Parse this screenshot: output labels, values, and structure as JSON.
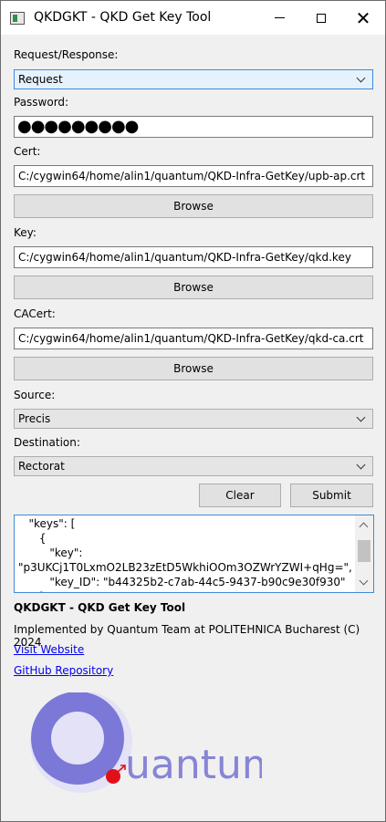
{
  "window": {
    "title": "QKDGKT - QKD Get Key Tool",
    "icons": {
      "minimize": "minimize-icon",
      "maximize": "maximize-icon",
      "close": "close-icon"
    }
  },
  "form": {
    "request_label": "Request/Response:",
    "request_value": "Request",
    "password_label": "Password:",
    "password_mask": "●●●●●●●●●",
    "cert_label": "Cert:",
    "cert_value": "C:/cygwin64/home/alin1/quantum/QKD-Infra-GetKey/upb-ap.crt",
    "key_label": "Key:",
    "key_value": "C:/cygwin64/home/alin1/quantum/QKD-Infra-GetKey/qkd.key",
    "cacert_label": "CACert:",
    "cacert_value": "C:/cygwin64/home/alin1/quantum/QKD-Infra-GetKey/qkd-ca.crt",
    "browse_label": "Browse",
    "source_label": "Source:",
    "source_value": "Precis",
    "destination_label": "Destination:",
    "destination_value": "Rectorat",
    "clear_label": "Clear",
    "submit_label": "Submit"
  },
  "output": {
    "lines": [
      "   \"keys\": [",
      "      {",
      "         \"key\":",
      "\"p3UKCj1T0LxmO2LB23zEtD5WkhiOOm3OZWrYZWI+qHg=\",",
      "         \"key_ID\": \"b44325b2-c7ab-44c5-9437-b90c9e30f930\"",
      "      }"
    ]
  },
  "footer": {
    "app_title": "QKDGKT - QKD Get Key Tool",
    "implemented_by": "Implemented by Quantum Team at POLITEHNICA Bucharest (C) 2024",
    "website_link": "Visit Website",
    "github_link": "GitHub Repository"
  },
  "logo": {
    "text": "uantum",
    "colors": {
      "ring_dark": "#7b78d8",
      "ring_light": "#e4e2f7",
      "dot": "#e0101a",
      "text": "#8785d6"
    }
  },
  "colors": {
    "focus_border": "#3f8ad8",
    "link": "#0000ee"
  }
}
